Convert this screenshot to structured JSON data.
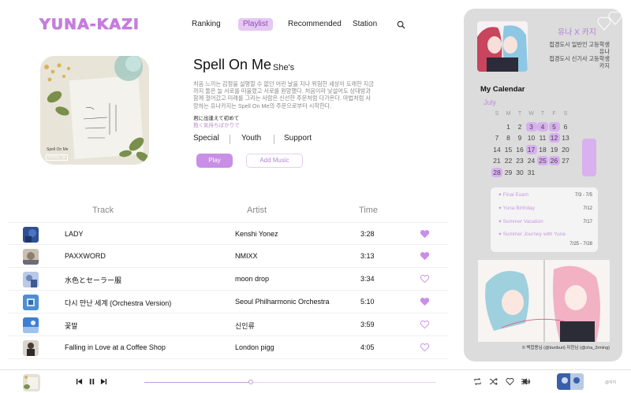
{
  "app": {
    "logo": "YUNA-KAZI"
  },
  "nav": {
    "items": [
      {
        "label": "Ranking",
        "active": false
      },
      {
        "label": "Playlist",
        "active": true
      },
      {
        "label": "Recommended",
        "active": false
      },
      {
        "label": "Station",
        "active": false
      }
    ],
    "search_icon": "search-icon"
  },
  "album": {
    "cover_label": "Spell On Me",
    "cover_tag": "SHE'S"
  },
  "song": {
    "title": "Spell On Me",
    "artist": "She's",
    "description": "처음 느끼는 감정을 설명할 수 없던 어린 날을 지나 위험한 세상이 도래한 지금까지 둘은 늘 서로를 떠올렸고 서로를 원망했다. 처음이라 낯설어도 상대방과 함께 걸어갔고 미래를 그리는 사람은 신선한 주문처럼 다가온다. 마법처럼 사랑하는 유나카지는 Spell On Me의 주문으로부터 시작한다.",
    "jp_line1": "君に出逢えて初めて",
    "jp_line2": "抱く気持ちばかりで"
  },
  "tabs": [
    "Special",
    "Youth",
    "Support"
  ],
  "buttons": {
    "play": "Play",
    "add_music": "Add Music"
  },
  "table": {
    "headers": {
      "track": "Track",
      "artist": "Artist",
      "time": "Time"
    },
    "rows": [
      {
        "track": "LADY",
        "artist": "Kenshi Yonez",
        "time": "3:28",
        "liked": true
      },
      {
        "track": "PAXXWORD",
        "artist": "NMIXX",
        "time": "3:13",
        "liked": true
      },
      {
        "track": "水色とセーラー服",
        "artist": "moon drop",
        "time": "3:34",
        "liked": false
      },
      {
        "track": "다시 만난 세계 (Orchestra Version)",
        "artist": "Seoul Philharmonic Orchestra",
        "time": "5:10",
        "liked": true
      },
      {
        "track": "꽃말",
        "artist": "신인류",
        "time": "3:59",
        "liked": false
      },
      {
        "track": "Falling in Love at a Coffee Shop",
        "artist": "London pigg",
        "time": "4:05",
        "liked": false
      }
    ]
  },
  "profile": {
    "title": "유나 X 카지",
    "line1": "접경도시 일반인 고등학생",
    "line2": "유나",
    "line3": "접경도시 신기사 고등학생",
    "line4": "카지"
  },
  "calendar": {
    "title": "My Calendar",
    "month": "July",
    "weekdays": [
      "S",
      "M",
      "T",
      "W",
      "T",
      "F",
      "S"
    ],
    "weeks": [
      [
        "",
        "1",
        "2",
        "3",
        "4",
        "5",
        "6"
      ],
      [
        "7",
        "8",
        "9",
        "10",
        "11",
        "12",
        "13"
      ],
      [
        "14",
        "15",
        "16",
        "17",
        "18",
        "19",
        "20"
      ],
      [
        "21",
        "22",
        "23",
        "24",
        "25",
        "26",
        "27"
      ],
      [
        "28",
        "29",
        "30",
        "31",
        "",
        "",
        ""
      ]
    ],
    "highlighted": [
      "3",
      "4",
      "5",
      "12",
      "17",
      "25",
      "26",
      "28"
    ]
  },
  "events": [
    {
      "name": "Final Exam",
      "date": "7/3 - 7/5"
    },
    {
      "name": "Yuna Birthday",
      "date": "7/12"
    },
    {
      "name": "Summer Vacation",
      "date": "7/17"
    },
    {
      "name": "Summer Journey with Yuna",
      "date": "7/25 - 7/28"
    }
  ],
  "credit": "© 백합용님 (@buriburi) 자헌님 (@cha_2rming)",
  "player": {
    "small_credit": "@자지"
  },
  "colors": {
    "accent": "#c98ee6",
    "accent_light": "#e6c8f3",
    "panel_bg": "#dcdcdc"
  }
}
